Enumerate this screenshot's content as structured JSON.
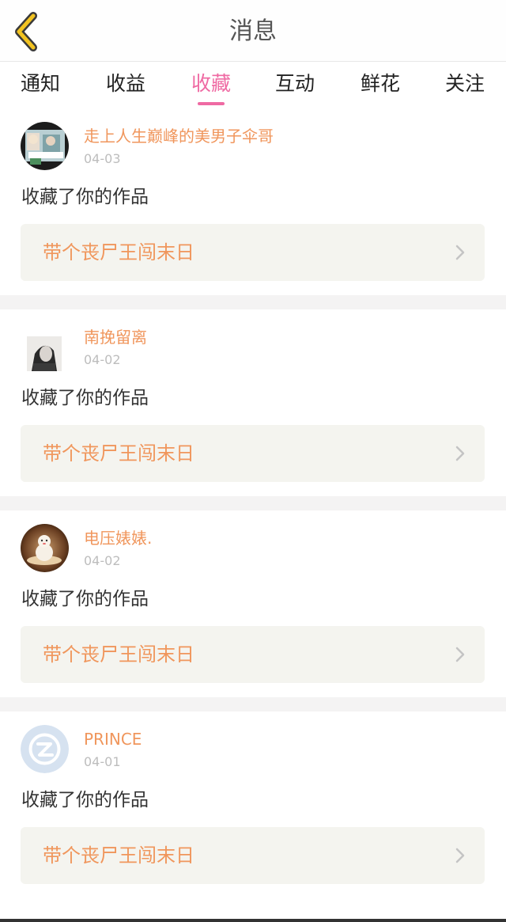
{
  "header": {
    "title": "消息",
    "back_icon": "back-chevron-icon"
  },
  "tabs": [
    {
      "label": "通知",
      "active": false
    },
    {
      "label": "收益",
      "active": false
    },
    {
      "label": "收藏",
      "active": true
    },
    {
      "label": "互动",
      "active": false
    },
    {
      "label": "鲜花",
      "active": false
    },
    {
      "label": "关注",
      "active": false
    }
  ],
  "colors": {
    "accent_pink": "#ef6aa3",
    "orange_text": "#f0965c",
    "back_icon_yellow": "#f2c321"
  },
  "messages": [
    {
      "username": "走上人生巅峰的美男子伞哥",
      "date": "04-03",
      "action": "收藏了你的作品",
      "work_title": "带个丧尸王闯末日"
    },
    {
      "username": "南挽留离",
      "date": "04-02",
      "action": "收藏了你的作品",
      "work_title": "带个丧尸王闯末日"
    },
    {
      "username": "电压婊婊.",
      "date": "04-02",
      "action": "收藏了你的作品",
      "work_title": "带个丧尸王闯末日"
    },
    {
      "username": "PRINCE",
      "date": "04-01",
      "action": "收藏了你的作品",
      "work_title": "带个丧尸王闯末日"
    }
  ]
}
